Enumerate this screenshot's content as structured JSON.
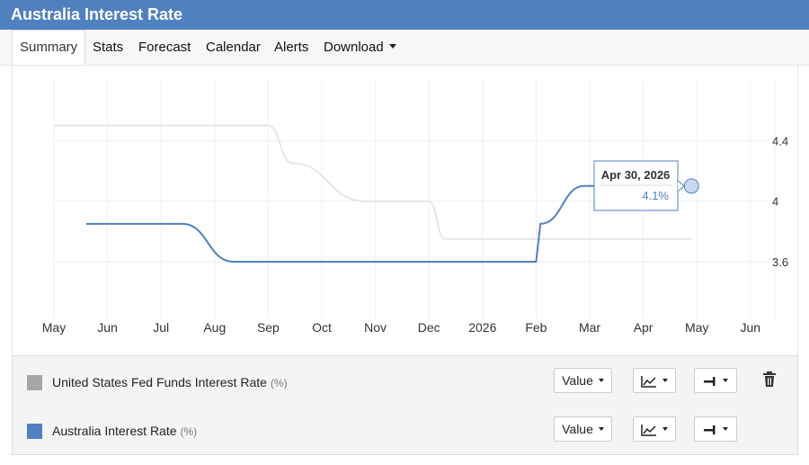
{
  "header": {
    "title": "Australia Interest Rate"
  },
  "nav": {
    "tabs": [
      {
        "label": "Summary",
        "active": true
      },
      {
        "label": "Stats"
      },
      {
        "label": "Forecast"
      },
      {
        "label": "Calendar"
      },
      {
        "label": "Alerts"
      },
      {
        "label": "Download",
        "dropdown": true
      }
    ]
  },
  "chart_data": {
    "type": "line",
    "x_ticks": [
      "May",
      "Jun",
      "Jul",
      "Aug",
      "Sep",
      "Oct",
      "Nov",
      "Dec",
      "2026",
      "Feb",
      "Mar",
      "Apr",
      "May",
      "Jun"
    ],
    "y_ticks": [
      3.6,
      4,
      4.4
    ],
    "ylim": [
      3.22,
      4.8
    ],
    "y_axis_side": "right",
    "grid": true,
    "series": [
      {
        "name": "United States Fed Funds Interest Rate",
        "color": "#e6e6e6",
        "points": [
          [
            0,
            4.5
          ],
          [
            4,
            4.5
          ],
          [
            4.45,
            4.25
          ],
          [
            5.8,
            4.0
          ],
          [
            7.0,
            4.0
          ],
          [
            7.3,
            3.75
          ],
          [
            11.9,
            3.75
          ]
        ]
      },
      {
        "name": "Australia Interest Rate",
        "color": "#4f80c0",
        "points": [
          [
            0.6,
            3.85
          ],
          [
            2.4,
            3.85
          ],
          [
            3.35,
            3.6
          ],
          [
            9.0,
            3.6
          ],
          [
            9.08,
            3.85
          ],
          [
            9.9,
            4.1
          ],
          [
            11.9,
            4.1
          ]
        ]
      }
    ],
    "tooltip": {
      "date": "Apr 30, 2026",
      "value": "4.1%",
      "x": 11.9,
      "y": 4.1
    }
  },
  "legend": {
    "rows": [
      {
        "name": "United States Fed Funds Interest Rate",
        "unit": "(%)",
        "color": "#a6a6a6",
        "value_label": "Value",
        "chart_type_icon": "line-chart-icon",
        "axis_icon": "axis-right-icon",
        "delete_icon": "trash-icon"
      },
      {
        "name": "Australia Interest Rate",
        "unit": "(%)",
        "color": "#4f80c0",
        "value_label": "Value",
        "chart_type_icon": "line-chart-icon",
        "axis_icon": "axis-right-icon"
      }
    ]
  }
}
